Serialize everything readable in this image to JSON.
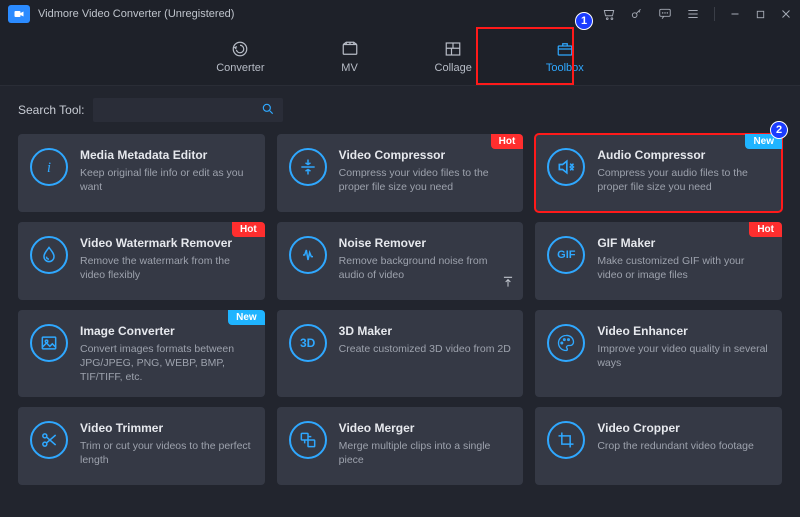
{
  "app": {
    "title": "Vidmore Video Converter (Unregistered)"
  },
  "nav": {
    "items": [
      {
        "label": "Converter"
      },
      {
        "label": "MV"
      },
      {
        "label": "Collage"
      },
      {
        "label": "Toolbox"
      }
    ]
  },
  "search": {
    "label": "Search Tool:"
  },
  "badges": {
    "hot": "Hot",
    "new": "New"
  },
  "pins": {
    "one": "1",
    "two": "2"
  },
  "tools": [
    {
      "title": "Media Metadata Editor",
      "desc": "Keep original file info or edit as you want"
    },
    {
      "title": "Video Compressor",
      "desc": "Compress your video files to the proper file size you need"
    },
    {
      "title": "Audio Compressor",
      "desc": "Compress your audio files to the proper file size you need"
    },
    {
      "title": "Video Watermark Remover",
      "desc": "Remove the watermark from the video flexibly"
    },
    {
      "title": "Noise Remover",
      "desc": "Remove background noise from audio of video"
    },
    {
      "title": "GIF Maker",
      "desc": "Make customized GIF with your video or image files"
    },
    {
      "title": "Image Converter",
      "desc": "Convert images formats between JPG/JPEG, PNG, WEBP, BMP, TIF/TIFF, etc."
    },
    {
      "title": "3D Maker",
      "desc": "Create customized 3D video from 2D"
    },
    {
      "title": "Video Enhancer",
      "desc": "Improve your video quality in several ways"
    },
    {
      "title": "Video Trimmer",
      "desc": "Trim or cut your videos to the perfect length"
    },
    {
      "title": "Video Merger",
      "desc": "Merge multiple clips into a single piece"
    },
    {
      "title": "Video Cropper",
      "desc": "Crop the redundant video footage"
    }
  ]
}
